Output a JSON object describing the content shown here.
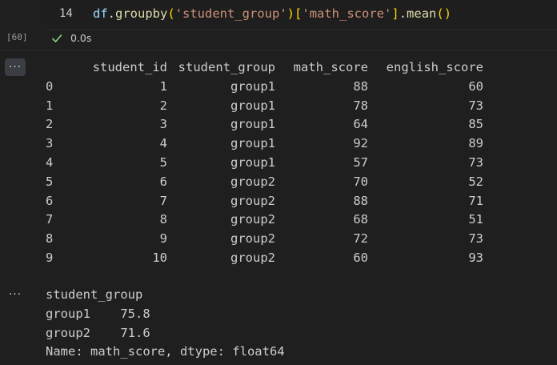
{
  "cell": {
    "line_number": "14",
    "code_tokens": [
      {
        "text": "df",
        "kind": "var"
      },
      {
        "text": ".",
        "kind": "punc"
      },
      {
        "text": "groupby",
        "kind": "fn"
      },
      {
        "text": "(",
        "kind": "br1"
      },
      {
        "text": "'student_group'",
        "kind": "str"
      },
      {
        "text": ")",
        "kind": "br1"
      },
      {
        "text": "[",
        "kind": "br1"
      },
      {
        "text": "'math_score'",
        "kind": "str"
      },
      {
        "text": "]",
        "kind": "br1"
      },
      {
        "text": ".",
        "kind": "punc"
      },
      {
        "text": "mean",
        "kind": "fn"
      },
      {
        "text": "()",
        "kind": "br1"
      }
    ],
    "execution_count": "[60]",
    "status_time": "0.0s",
    "status_icon": "check-icon"
  },
  "output_menu_label": "···",
  "dataframe": {
    "columns": [
      "student_id",
      "student_group",
      "math_score",
      "english_score"
    ],
    "rows": [
      {
        "index": "0",
        "student_id": "1",
        "student_group": "group1",
        "math_score": "88",
        "english_score": "60"
      },
      {
        "index": "1",
        "student_id": "2",
        "student_group": "group1",
        "math_score": "78",
        "english_score": "73"
      },
      {
        "index": "2",
        "student_id": "3",
        "student_group": "group1",
        "math_score": "64",
        "english_score": "85"
      },
      {
        "index": "3",
        "student_id": "4",
        "student_group": "group1",
        "math_score": "92",
        "english_score": "89"
      },
      {
        "index": "4",
        "student_id": "5",
        "student_group": "group1",
        "math_score": "57",
        "english_score": "73"
      },
      {
        "index": "5",
        "student_id": "6",
        "student_group": "group2",
        "math_score": "70",
        "english_score": "52"
      },
      {
        "index": "6",
        "student_id": "7",
        "student_group": "group2",
        "math_score": "88",
        "english_score": "71"
      },
      {
        "index": "7",
        "student_id": "8",
        "student_group": "group2",
        "math_score": "68",
        "english_score": "51"
      },
      {
        "index": "8",
        "student_id": "9",
        "student_group": "group2",
        "math_score": "72",
        "english_score": "73"
      },
      {
        "index": "9",
        "student_id": "10",
        "student_group": "group2",
        "math_score": "60",
        "english_score": "93"
      }
    ]
  },
  "series_output": {
    "lines": [
      "student_group",
      "group1    75.8",
      "group2    71.6",
      "Name: math_score, dtype: float64"
    ]
  },
  "colors": {
    "background": "#1f1f1f",
    "string": "#ce9178",
    "function": "#dcdcaa",
    "variable": "#9cdcfe",
    "bracket": "#ffd700",
    "check": "#89d185"
  }
}
